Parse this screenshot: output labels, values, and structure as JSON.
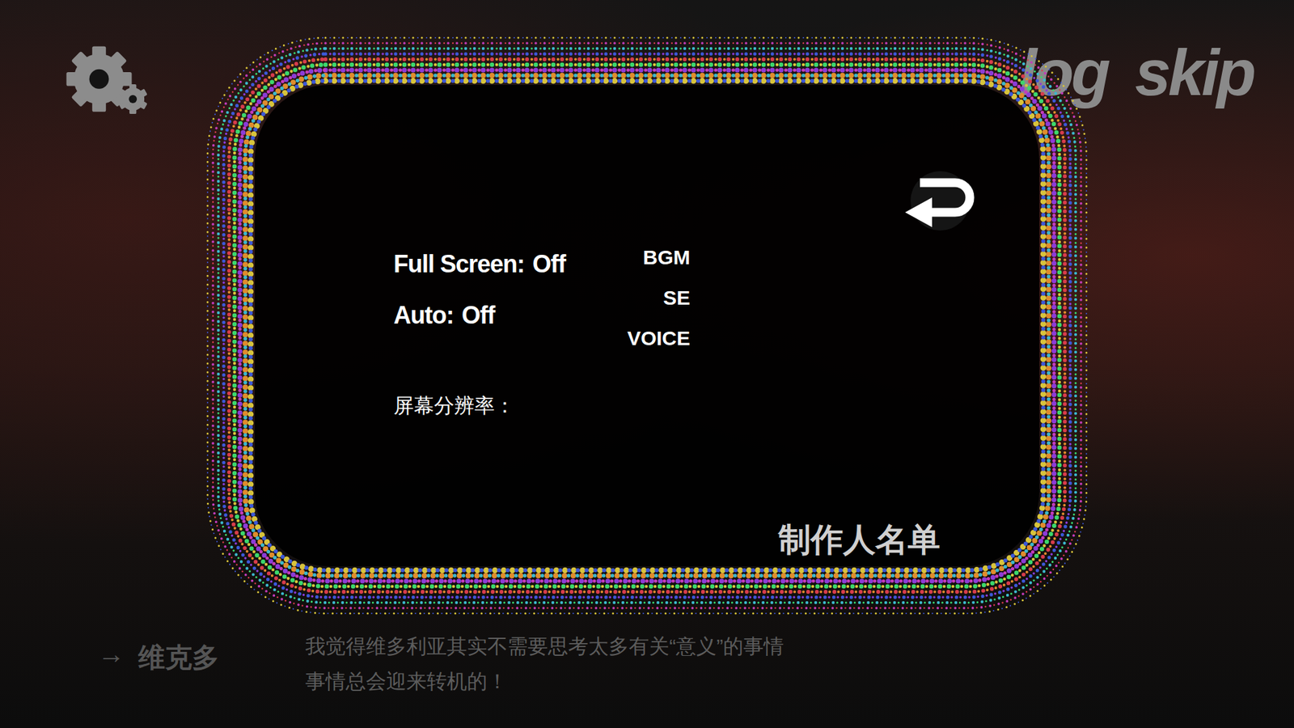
{
  "hud": {
    "buttons": [
      "log",
      "skip"
    ]
  },
  "settings": {
    "toggles": [
      {
        "label": "Full Screen:",
        "value": "Off"
      },
      {
        "label": "Auto:",
        "value": "Off"
      }
    ],
    "volumes": [
      "BGM",
      "SE",
      "VOICE"
    ],
    "resolution_label": "屏幕分辨率：",
    "credits": "制作人名单"
  },
  "dialogue": {
    "arrow": "→",
    "speaker": "维克多",
    "lines": [
      "我觉得维多利亚其实不需要思考太多有关“意义”的事情",
      "事情总会迎来转机的！"
    ]
  }
}
